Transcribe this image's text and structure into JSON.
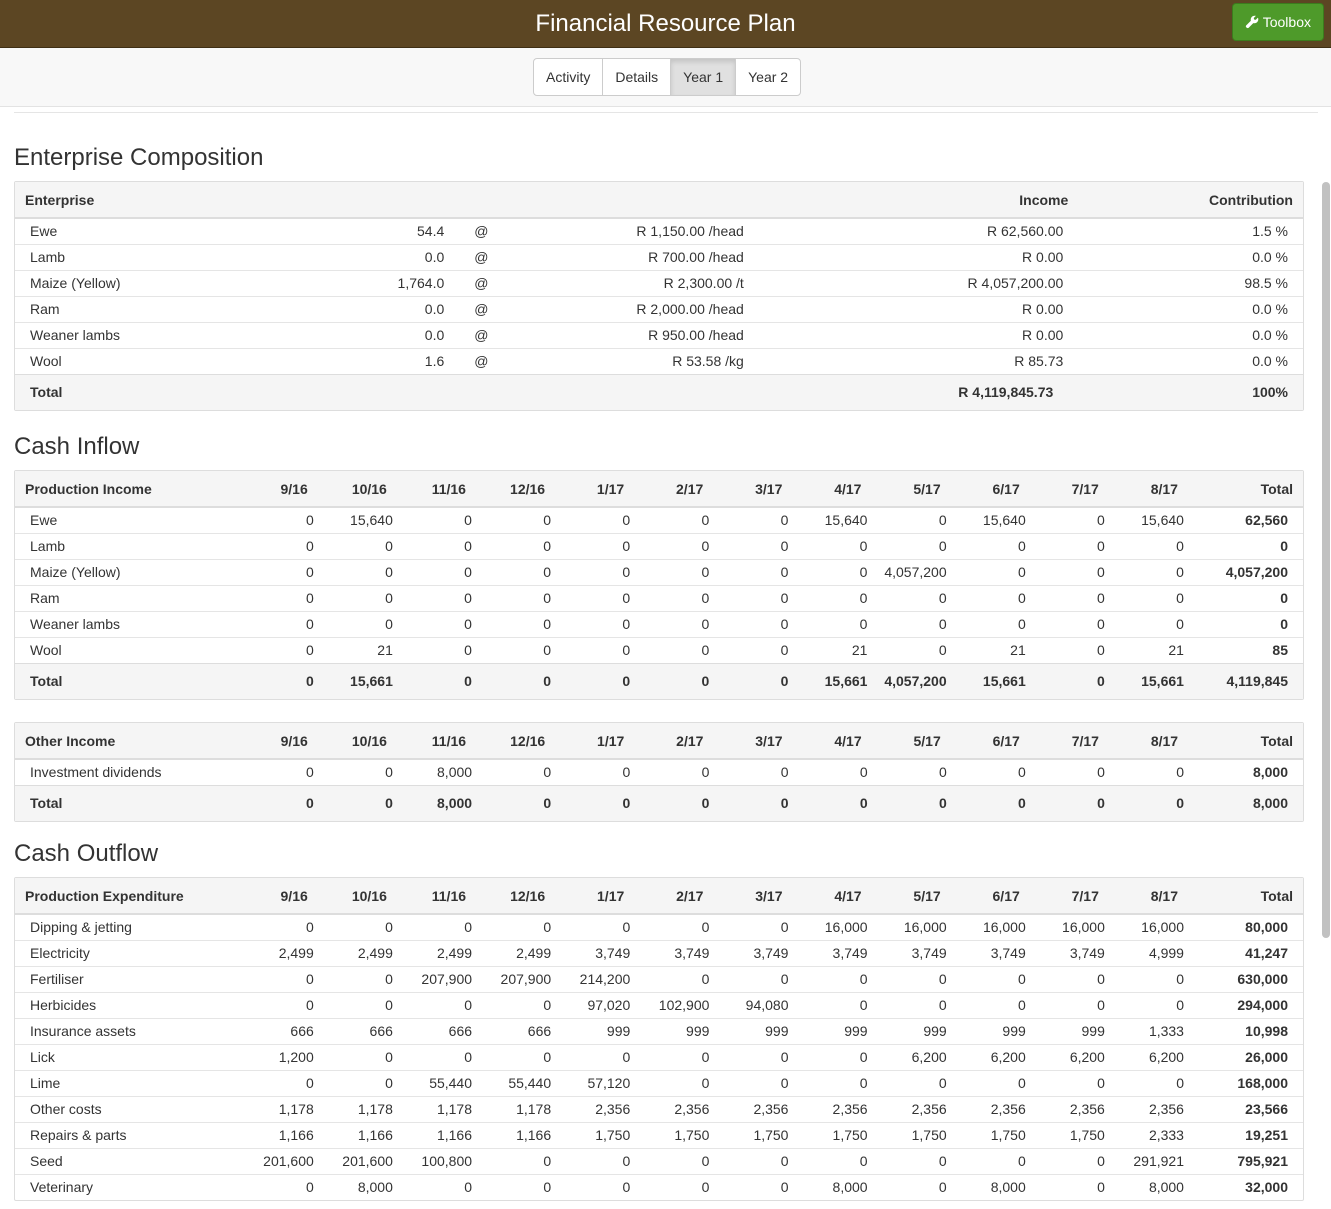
{
  "header": {
    "title": "Financial Resource Plan",
    "toolbox_label": "Toolbox"
  },
  "tabs": [
    {
      "label": "Activity",
      "active": false
    },
    {
      "label": "Details",
      "active": false
    },
    {
      "label": "Year 1",
      "active": true
    },
    {
      "label": "Year 2",
      "active": false
    }
  ],
  "enterprise": {
    "heading": "Enterprise Composition",
    "headers": {
      "enterprise": "Enterprise",
      "income": "Income",
      "contribution": "Contribution"
    },
    "rows": [
      {
        "name": "Ewe",
        "qty": "54.4",
        "at": "@",
        "price": "R 1,150.00 /head",
        "income": "R 62,560.00",
        "contribution": "1.5 %"
      },
      {
        "name": "Lamb",
        "qty": "0.0",
        "at": "@",
        "price": "R 700.00 /head",
        "income": "R 0.00",
        "contribution": "0.0 %"
      },
      {
        "name": "Maize (Yellow)",
        "qty": "1,764.0",
        "at": "@",
        "price": "R 2,300.00 /t",
        "income": "R 4,057,200.00",
        "contribution": "98.5 %"
      },
      {
        "name": "Ram",
        "qty": "0.0",
        "at": "@",
        "price": "R 2,000.00 /head",
        "income": "R 0.00",
        "contribution": "0.0 %"
      },
      {
        "name": "Weaner lambs",
        "qty": "0.0",
        "at": "@",
        "price": "R 950.00 /head",
        "income": "R 0.00",
        "contribution": "0.0 %"
      },
      {
        "name": "Wool",
        "qty": "1.6",
        "at": "@",
        "price": "R 53.58 /kg",
        "income": "R 85.73",
        "contribution": "0.0 %"
      }
    ],
    "total": {
      "label": "Total",
      "income": "R 4,119,845.73",
      "contribution": "100%"
    }
  },
  "months": [
    "9/16",
    "10/16",
    "11/16",
    "12/16",
    "1/17",
    "2/17",
    "3/17",
    "4/17",
    "5/17",
    "6/17",
    "7/17",
    "8/17"
  ],
  "total_label": "Total",
  "cash_inflow": {
    "heading": "Cash Inflow",
    "production": {
      "title": "Production Income",
      "rows": [
        {
          "name": "Ewe",
          "values": [
            "0",
            "15,640",
            "0",
            "0",
            "0",
            "0",
            "0",
            "15,640",
            "0",
            "15,640",
            "0",
            "15,640"
          ],
          "total": "62,560"
        },
        {
          "name": "Lamb",
          "values": [
            "0",
            "0",
            "0",
            "0",
            "0",
            "0",
            "0",
            "0",
            "0",
            "0",
            "0",
            "0"
          ],
          "total": "0"
        },
        {
          "name": "Maize (Yellow)",
          "values": [
            "0",
            "0",
            "0",
            "0",
            "0",
            "0",
            "0",
            "0",
            "4,057,200",
            "0",
            "0",
            "0"
          ],
          "total": "4,057,200"
        },
        {
          "name": "Ram",
          "values": [
            "0",
            "0",
            "0",
            "0",
            "0",
            "0",
            "0",
            "0",
            "0",
            "0",
            "0",
            "0"
          ],
          "total": "0"
        },
        {
          "name": "Weaner lambs",
          "values": [
            "0",
            "0",
            "0",
            "0",
            "0",
            "0",
            "0",
            "0",
            "0",
            "0",
            "0",
            "0"
          ],
          "total": "0"
        },
        {
          "name": "Wool",
          "values": [
            "0",
            "21",
            "0",
            "0",
            "0",
            "0",
            "0",
            "21",
            "0",
            "21",
            "0",
            "21"
          ],
          "total": "85"
        }
      ],
      "total": {
        "label": "Total",
        "values": [
          "0",
          "15,661",
          "0",
          "0",
          "0",
          "0",
          "0",
          "15,661",
          "4,057,200",
          "15,661",
          "0",
          "15,661"
        ],
        "total": "4,119,845"
      }
    },
    "other": {
      "title": "Other Income",
      "rows": [
        {
          "name": "Investment dividends",
          "values": [
            "0",
            "0",
            "8,000",
            "0",
            "0",
            "0",
            "0",
            "0",
            "0",
            "0",
            "0",
            "0"
          ],
          "total": "8,000"
        }
      ],
      "total": {
        "label": "Total",
        "values": [
          "0",
          "0",
          "8,000",
          "0",
          "0",
          "0",
          "0",
          "0",
          "0",
          "0",
          "0",
          "0"
        ],
        "total": "8,000"
      }
    }
  },
  "cash_outflow": {
    "heading": "Cash Outflow",
    "production": {
      "title": "Production Expenditure",
      "rows": [
        {
          "name": "Dipping & jetting",
          "values": [
            "0",
            "0",
            "0",
            "0",
            "0",
            "0",
            "0",
            "16,000",
            "16,000",
            "16,000",
            "16,000",
            "16,000"
          ],
          "total": "80,000"
        },
        {
          "name": "Electricity",
          "values": [
            "2,499",
            "2,499",
            "2,499",
            "2,499",
            "3,749",
            "3,749",
            "3,749",
            "3,749",
            "3,749",
            "3,749",
            "3,749",
            "4,999"
          ],
          "total": "41,247"
        },
        {
          "name": "Fertiliser",
          "values": [
            "0",
            "0",
            "207,900",
            "207,900",
            "214,200",
            "0",
            "0",
            "0",
            "0",
            "0",
            "0",
            "0"
          ],
          "total": "630,000"
        },
        {
          "name": "Herbicides",
          "values": [
            "0",
            "0",
            "0",
            "0",
            "97,020",
            "102,900",
            "94,080",
            "0",
            "0",
            "0",
            "0",
            "0"
          ],
          "total": "294,000"
        },
        {
          "name": "Insurance assets",
          "values": [
            "666",
            "666",
            "666",
            "666",
            "999",
            "999",
            "999",
            "999",
            "999",
            "999",
            "999",
            "1,333"
          ],
          "total": "10,998"
        },
        {
          "name": "Lick",
          "values": [
            "1,200",
            "0",
            "0",
            "0",
            "0",
            "0",
            "0",
            "0",
            "6,200",
            "6,200",
            "6,200",
            "6,200"
          ],
          "total": "26,000"
        },
        {
          "name": "Lime",
          "values": [
            "0",
            "0",
            "55,440",
            "55,440",
            "57,120",
            "0",
            "0",
            "0",
            "0",
            "0",
            "0",
            "0"
          ],
          "total": "168,000"
        },
        {
          "name": "Other costs",
          "values": [
            "1,178",
            "1,178",
            "1,178",
            "1,178",
            "2,356",
            "2,356",
            "2,356",
            "2,356",
            "2,356",
            "2,356",
            "2,356",
            "2,356"
          ],
          "total": "23,566"
        },
        {
          "name": "Repairs & parts",
          "values": [
            "1,166",
            "1,166",
            "1,166",
            "1,166",
            "1,750",
            "1,750",
            "1,750",
            "1,750",
            "1,750",
            "1,750",
            "1,750",
            "2,333"
          ],
          "total": "19,251"
        },
        {
          "name": "Seed",
          "values": [
            "201,600",
            "201,600",
            "100,800",
            "0",
            "0",
            "0",
            "0",
            "0",
            "0",
            "0",
            "0",
            "291,921"
          ],
          "total": "795,921"
        },
        {
          "name": "Veterinary",
          "values": [
            "0",
            "8,000",
            "0",
            "0",
            "0",
            "0",
            "0",
            "8,000",
            "0",
            "8,000",
            "0",
            "8,000"
          ],
          "total": "32,000"
        }
      ]
    }
  }
}
